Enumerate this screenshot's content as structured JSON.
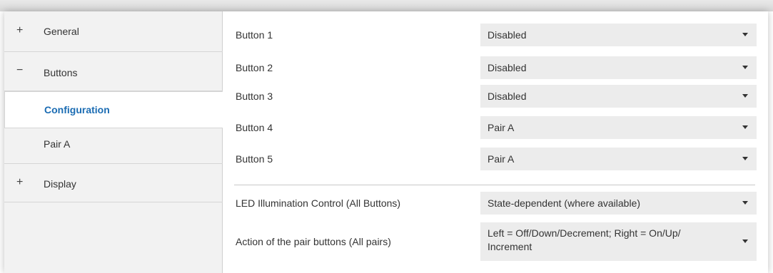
{
  "sidebar": {
    "general": {
      "sign": "+",
      "label": "General"
    },
    "buttons": {
      "sign": "−",
      "label": "Buttons"
    },
    "configuration": {
      "label": "Configuration"
    },
    "pair_a": {
      "label": "Pair A"
    },
    "display": {
      "sign": "+",
      "label": "Display"
    }
  },
  "main": {
    "rows": [
      {
        "label": "Button 1",
        "value": "Disabled"
      },
      {
        "label": "Button 2",
        "value": "Disabled"
      },
      {
        "label": "Button 3",
        "value": "Disabled"
      },
      {
        "label": "Button 4",
        "value": "Pair A"
      },
      {
        "label": "Button 5",
        "value": "Pair A"
      },
      {
        "label": "LED Illumination Control (All Buttons)",
        "value": "State-dependent (where available)"
      },
      {
        "label": "Action of the pair buttons (All pairs)",
        "value": "Left = Off/Down/Decrement; Right = On/Up/ Increment"
      }
    ]
  },
  "colors": {
    "accent": "#1b6cb3",
    "sidebar_bg": "#f2f2f2",
    "select_bg": "#ececec"
  },
  "icons": {
    "dropdown": "chevron-down-icon",
    "expand": "plus-icon",
    "collapse": "minus-icon"
  }
}
